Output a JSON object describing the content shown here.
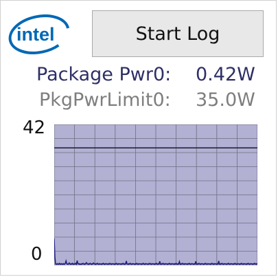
{
  "logo": {
    "text": "intel",
    "color": "#0068b5"
  },
  "controls": {
    "start_label": "Start Log"
  },
  "readouts": {
    "package_power": {
      "label": "Package Pwr0:",
      "value": "0.42W",
      "color": "#2e2f66"
    },
    "pkg_power_limit": {
      "label": "PkgPwrLimit0:",
      "value": "35.0W",
      "color": "#7e7e7e"
    }
  },
  "colors": {
    "plot_background": "#b2b0d3",
    "grid": "#6f6f80",
    "series": "#1c1b80",
    "limit_line": "#1a1a2a"
  },
  "chart_data": {
    "type": "line",
    "ylim": [
      0,
      42
    ],
    "y_tick_labels": [
      "42",
      "0"
    ],
    "grid": true,
    "limit_line": 35.0,
    "series": [
      {
        "values": [
          8,
          2.5,
          0.5,
          0.3,
          0.4,
          0.5,
          0.3,
          0.4,
          0.6,
          0.3,
          0.4,
          0.5,
          0.3,
          0.4,
          0.5,
          0.3,
          0.4,
          0.6,
          1.3,
          0.5,
          0.4,
          0.3,
          0.5,
          0.7,
          0.4,
          0.3,
          0.5,
          0.4,
          0.6,
          0.3,
          0.4,
          0.5,
          0.4,
          0.6,
          0.3,
          1.4,
          0.6,
          0.4,
          0.5,
          0.3,
          0.4,
          0.3,
          0.5,
          0.4,
          0.6,
          0.4,
          0.3,
          0.5,
          0.4,
          0.8,
          0.6,
          0.4,
          0.3,
          0.5,
          0.4,
          0.6,
          0.4,
          0.3,
          0.5,
          0.4,
          0.7,
          0.5,
          0.4,
          0.3,
          0.5,
          0.4,
          0.6,
          0.4,
          0.3,
          0.5,
          0.4,
          0.4,
          0.3,
          0.5,
          0.4,
          0.6,
          0.4,
          0.3,
          0.5,
          0.4,
          0.5,
          0.4,
          0.3,
          0.5,
          0.4,
          0.6,
          0.4,
          0.3,
          0.5,
          0.4,
          0.5,
          0.4,
          0.3,
          0.5,
          0.4,
          0.6,
          0.4,
          0.3,
          0.5,
          0.4,
          0.5,
          0.4,
          0.3,
          0.5,
          0.4,
          0.6,
          0.4,
          0.3,
          0.5,
          0.4,
          1.3,
          0.5,
          0.4,
          0.3,
          0.5,
          0.4,
          0.6,
          0.4,
          0.3,
          0.5,
          0.4,
          0.5,
          0.4,
          0.3,
          0.5,
          0.4,
          0.6,
          0.4,
          0.3,
          0.5,
          0.4,
          0.5,
          0.4,
          0.3,
          0.5,
          0.4,
          0.6,
          0.4,
          0.3,
          0.5,
          0.4,
          0.5,
          0.4,
          0.3,
          0.5,
          0.4,
          0.6,
          0.4,
          0.3,
          0.5,
          0.4,
          0.5,
          0.4,
          0.3,
          0.5,
          0.4,
          0.6,
          0.4,
          0.3,
          0.5,
          0.4,
          1.2,
          0.4,
          0.3,
          0.5,
          0.4,
          0.6,
          0.4,
          0.3,
          0.5,
          0.4,
          0.5,
          0.4,
          0.3,
          0.5,
          0.4,
          0.6,
          0.4,
          0.3,
          0.5,
          0.4,
          0.5,
          0.4,
          0.3,
          0.5,
          0.4,
          0.6,
          0.4,
          0.3,
          0.5,
          0.4,
          1.1,
          0.4,
          0.3,
          0.5,
          0.4,
          0.6,
          0.4,
          0.3,
          0.5,
          0.4,
          0.5,
          0.4,
          0.3,
          0.5,
          0.4,
          0.6,
          0.4,
          0.3,
          0.5,
          0.4,
          0.5,
          0.4,
          0.3,
          0.5,
          0.4,
          1.2,
          0.4,
          0.3,
          0.5,
          0.4,
          0.6,
          0.4,
          0.3,
          0.5,
          0.4,
          0.5,
          0.4,
          0.3,
          0.5,
          0.4,
          0.6,
          0.4,
          0.3,
          0.5,
          0.4,
          0.5,
          0.4,
          0.3,
          0.5,
          0.4,
          0.6,
          0.4,
          0.3,
          0.5,
          0.4,
          0.5,
          0.4,
          0.3,
          0.5,
          0.4,
          1.3,
          0.4,
          0.3,
          0.5,
          0.4,
          0.6,
          0.4,
          0.3,
          0.5,
          0.4,
          0.5,
          0.4,
          0.3,
          0.5,
          0.4,
          0.6,
          0.4,
          0.3,
          0.5,
          0.4,
          0.5,
          0.4,
          0.3,
          0.5,
          0.4,
          0.6,
          0.4,
          0.3,
          0.5,
          0.4,
          0.5,
          0.4,
          0.3,
          0.5,
          0.4,
          0.6,
          0.4,
          0.3,
          0.5,
          0.4,
          0.5,
          0.4,
          0.3,
          0.5,
          0.4,
          0.6,
          0.4,
          0.3,
          0.5,
          0.4,
          0.5,
          0.4,
          0.3,
          0.5,
          0.4,
          0.6,
          0.4,
          0.3,
          0.5,
          0.42
        ]
      }
    ]
  }
}
